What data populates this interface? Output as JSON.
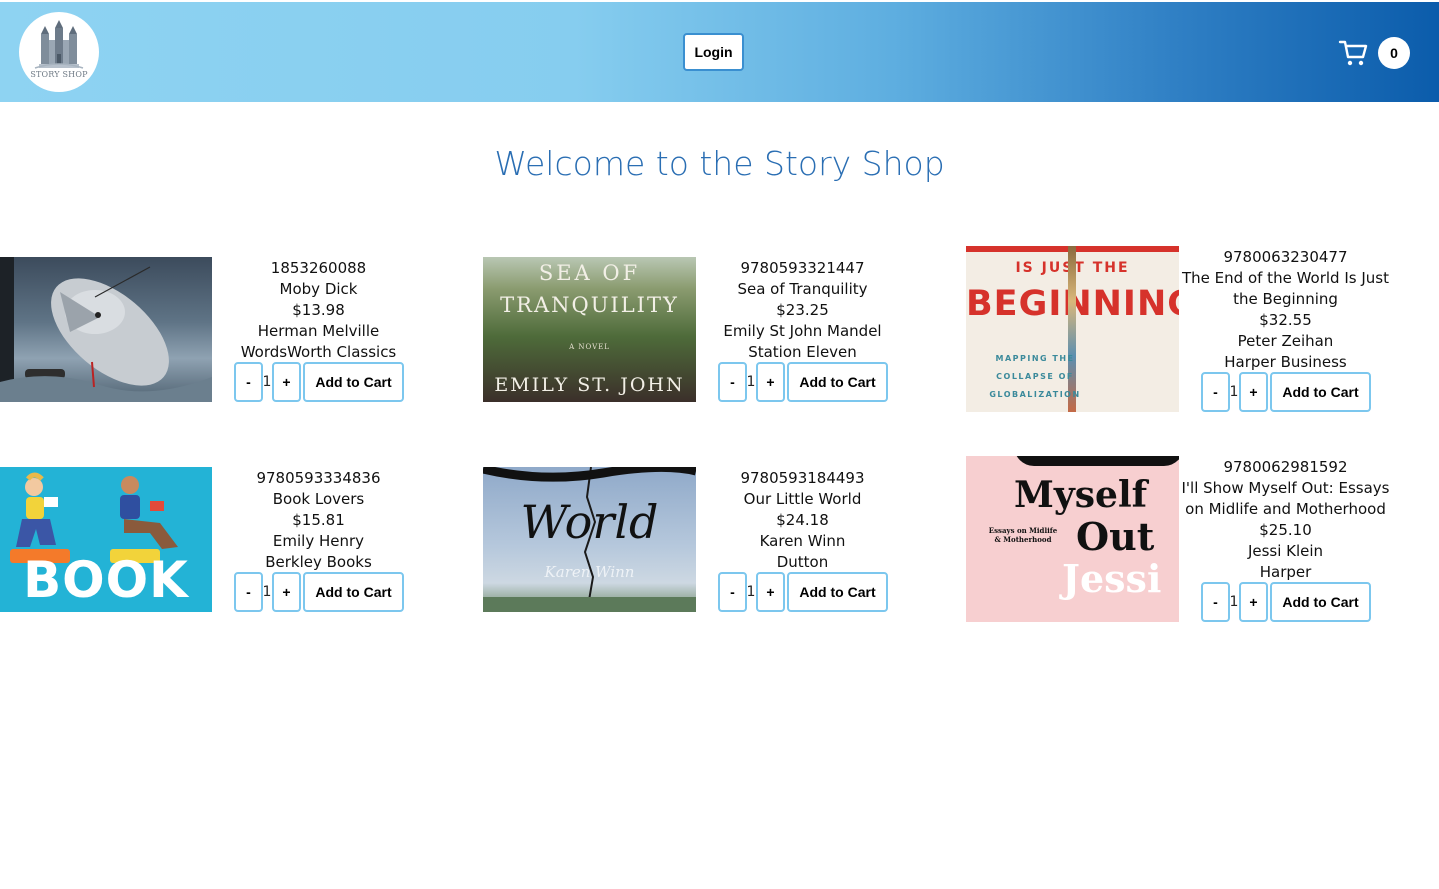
{
  "header": {
    "logo_text": "STORY SHOP",
    "login_label": "Login",
    "cart_count": "0",
    "gradient_colors": [
      "#8ed3f2",
      "#0b5cab"
    ]
  },
  "welcome": "Welcome to the Story Shop",
  "accent_color": "#7cc7ee",
  "books": [
    {
      "isbn": "1853260088",
      "title": "Moby Dick",
      "price": "$13.98",
      "author": "Herman Melville",
      "publisher": "WordsWorth Classics",
      "qty": "1",
      "minus": "-",
      "plus": "+",
      "add_label": "Add to Cart"
    },
    {
      "isbn": "9780593321447",
      "title": "Sea of Tranquility",
      "price": "$23.25",
      "author": "Emily St John Mandel",
      "publisher": "Station Eleven",
      "qty": "1",
      "minus": "-",
      "plus": "+",
      "add_label": "Add to Cart",
      "cover_top": "SEA OF",
      "cover_mid": "TRANQUILITY",
      "cover_small": "A NOVEL",
      "cover_bottom": "EMILY ST. JOHN"
    },
    {
      "isbn": "9780063230477",
      "title": "The End of the World Is Just the Beginning",
      "price": "$32.55",
      "author": "Peter Zeihan",
      "publisher": "Harper Business",
      "qty": "1",
      "minus": "-",
      "plus": "+",
      "add_label": "Add to Cart",
      "cover_top": "IS JUST THE",
      "cover_mid": "BEGINNING",
      "cover_sub1": "MAPPING THE",
      "cover_sub2": "COLLAPSE OF",
      "cover_sub3": "GLOBALIZATION"
    },
    {
      "isbn": "9780593334836",
      "title": "Book Lovers",
      "price": "$15.81",
      "author": "Emily Henry",
      "publisher": "Berkley Books",
      "qty": "1",
      "minus": "-",
      "plus": "+",
      "add_label": "Add to Cart",
      "cover_mid": "BOOK"
    },
    {
      "isbn": "9780593184493",
      "title": "Our Little World",
      "price": "$24.18",
      "author": "Karen Winn",
      "publisher": "Dutton",
      "qty": "1",
      "minus": "-",
      "plus": "+",
      "add_label": "Add to Cart",
      "cover_mid": "World",
      "cover_small": "Karen Winn"
    },
    {
      "isbn": "9780062981592",
      "title": "I'll Show Myself Out: Essays on Midlife and Motherhood",
      "price": "$25.10",
      "author": "Jessi Klein",
      "publisher": "Harper",
      "qty": "1",
      "minus": "-",
      "plus": "+",
      "add_label": "Add to Cart",
      "cover_top": "Myself",
      "cover_mid": "Out",
      "cover_small": "Essays on Midlife & Motherhood",
      "cover_bottom": "Jessi"
    }
  ]
}
